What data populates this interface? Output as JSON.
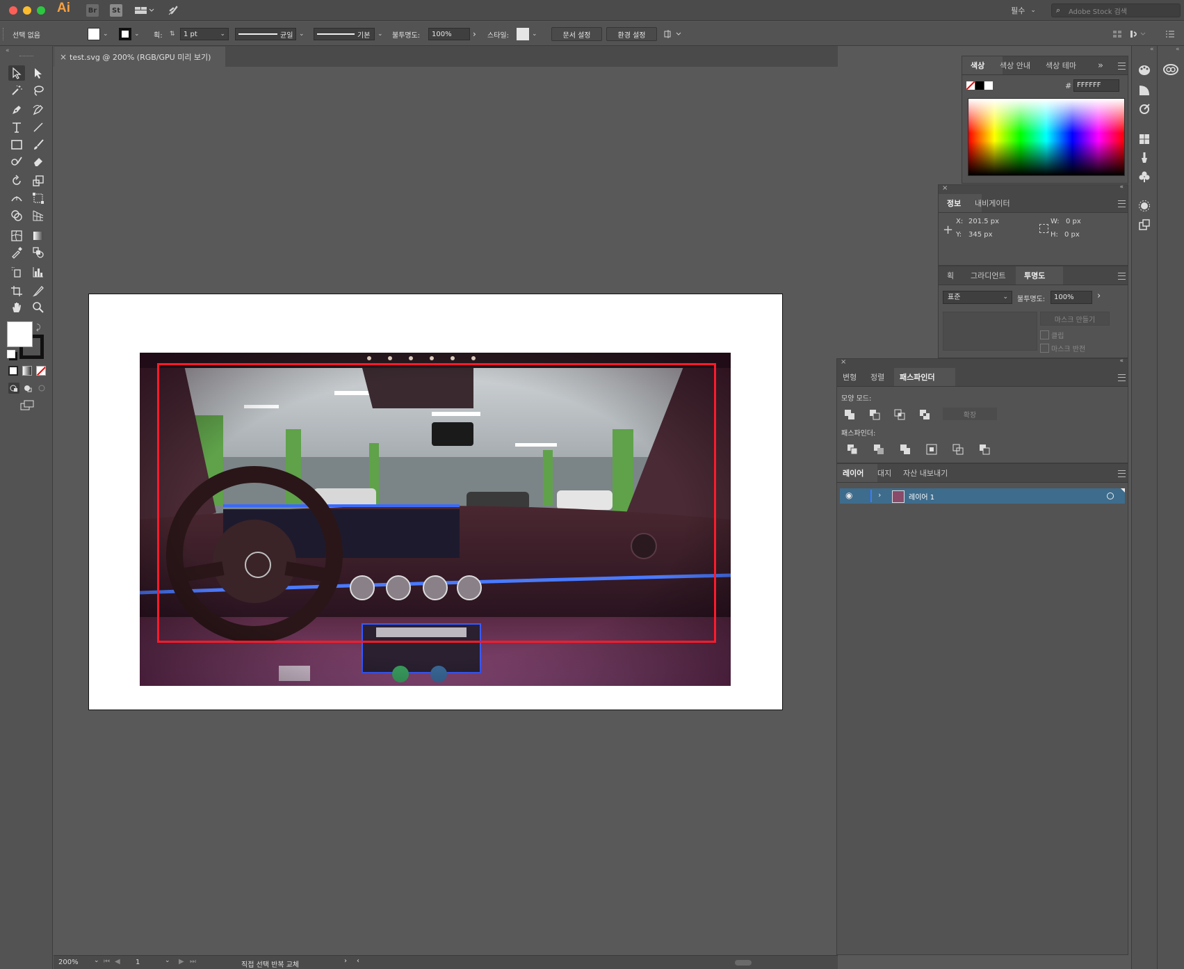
{
  "app": {
    "logo": "Ai",
    "bridge_badge": "Br",
    "stock_badge": "St",
    "workspace": "필수",
    "search_placeholder": "Adobe Stock 검색"
  },
  "control_bar": {
    "selection": "선택 없음",
    "stroke_label": "획:",
    "stroke_weight": "1 pt",
    "stroke_profile": "균일",
    "brush": "기본",
    "opacity_label": "불투명도:",
    "opacity_value": "100%",
    "style_label": "스타일:",
    "doc_setup": "문서 설정",
    "preferences": "환경 설정"
  },
  "document": {
    "tab_title": "test.svg @ 200% (RGB/GPU 미리 보기)",
    "close_glyph": "×"
  },
  "color_panel": {
    "tabs": [
      "색상",
      "색상 안내",
      "색상 테마"
    ],
    "hex_label": "#",
    "hex_value": "FFFFFF"
  },
  "info_panel": {
    "tabs": [
      "정보",
      "내비게이터"
    ],
    "x_label": "X:",
    "x_value": "201.5 px",
    "y_label": "Y:",
    "y_value": "345 px",
    "w_label": "W:",
    "w_value": "0 px",
    "h_label": "H:",
    "h_value": "0 px"
  },
  "transparency_panel": {
    "tabs": [
      "획",
      "그라디언트",
      "투명도"
    ],
    "blend_mode": "표준",
    "opacity_label": "불투명도:",
    "opacity_value": "100%",
    "make_mask": "마스크 만들기",
    "clip": "클립",
    "invert_mask": "마스크 반전"
  },
  "pathfinder_panel": {
    "tabs": [
      "변형",
      "정렬",
      "패스파인더"
    ],
    "shape_modes_label": "모양 모드:",
    "expand": "확장",
    "pathfinders_label": "패스파인더:"
  },
  "layers_panel": {
    "tabs": [
      "레이어",
      "대지",
      "자산 내보내기"
    ],
    "layer_name": "레이어 1"
  },
  "status_bar": {
    "zoom": "200%",
    "artboard_num": "1",
    "tool_info": "직접 선택 반복 교체"
  },
  "colors": {
    "layer_highlight": "#3e6c8c",
    "selection_red": "#ff1a2a",
    "panel_bg": "#535353"
  }
}
